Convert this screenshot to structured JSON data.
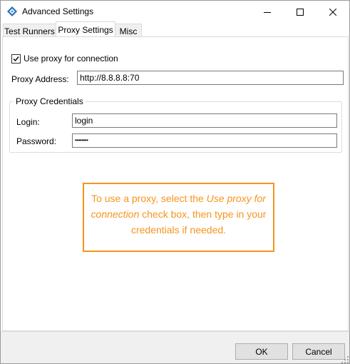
{
  "window": {
    "title": "Advanced Settings",
    "icons": {
      "app": "settings-app-icon",
      "minimize": "minimize-icon",
      "maximize": "maximize-icon",
      "close": "close-icon"
    }
  },
  "tabs": [
    {
      "label": "Test Runners",
      "active": false
    },
    {
      "label": "Proxy Settings",
      "active": true
    },
    {
      "label": "Misc",
      "active": false
    }
  ],
  "proxy": {
    "use_proxy_label": "Use proxy for connection",
    "use_proxy_checked": true,
    "address_label": "Proxy Address:",
    "address_value": "http://8.8.8.8:70",
    "credentials_title": "Proxy Credentials",
    "login_label": "Login:",
    "login_value": "login",
    "password_label": "Password:",
    "password_value": "••••••••"
  },
  "callout": {
    "text_before": "To use a proxy, select the ",
    "text_em": "Use proxy for connection",
    "text_after": " check box, then type in your credentials if needed.",
    "color": "#f7941d"
  },
  "buttons": {
    "ok": "OK",
    "cancel": "Cancel"
  }
}
